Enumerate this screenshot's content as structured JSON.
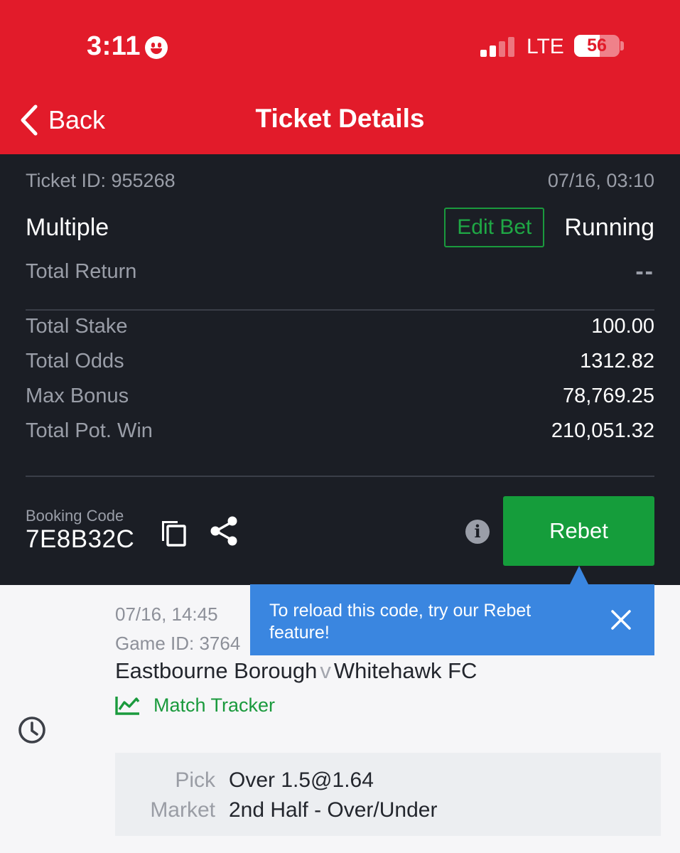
{
  "status_bar": {
    "time": "3:11",
    "network": "LTE",
    "battery": "56",
    "battery_level_percent": 56,
    "signal_bars_active": 2,
    "signal_bars_total": 4
  },
  "header": {
    "back_label": "Back",
    "title": "Ticket Details",
    "background_color": "#e21b2a"
  },
  "ticket": {
    "id_text": "Ticket ID: 955268",
    "datetime": "07/16, 03:10",
    "bet_type": "Multiple",
    "edit_bet_label": "Edit Bet",
    "status": "Running",
    "total_return_label": "Total Return",
    "total_return_value": "--",
    "stats": [
      {
        "label": "Total Stake",
        "value": "100.00"
      },
      {
        "label": "Total Odds",
        "value": "1312.82"
      },
      {
        "label": "Max Bonus",
        "value": "78,769.25"
      },
      {
        "label": "Total Pot. Win",
        "value": "210,051.32"
      }
    ],
    "booking_code_label": "Booking Code",
    "booking_code": "7E8B32C",
    "info_glyph": "i",
    "rebet_label": "Rebet"
  },
  "tooltip": {
    "text": "To reload this code, try our Rebet feature!",
    "color": "#3a86e0"
  },
  "event": {
    "datetime": "07/16, 14:45",
    "game_id": "Game ID: 3764",
    "home_team": "Eastbourne Borough",
    "vs": "v",
    "away_team": "Whitehawk FC",
    "match_tracker_label": "Match Tracker",
    "pick_label": "Pick",
    "pick_value": "Over 1.5@1.64",
    "market_label": "Market",
    "market_value": "2nd Half - Over/Under"
  },
  "colors": {
    "accent_green": "#159d3b",
    "panel_dark": "#1b1e25"
  },
  "icons": [
    "smiley-icon",
    "signal-icon",
    "battery-icon",
    "back-chevron-icon",
    "copy-icon",
    "share-icon",
    "info-icon",
    "close-icon",
    "match-tracker-icon",
    "clock-icon"
  ]
}
